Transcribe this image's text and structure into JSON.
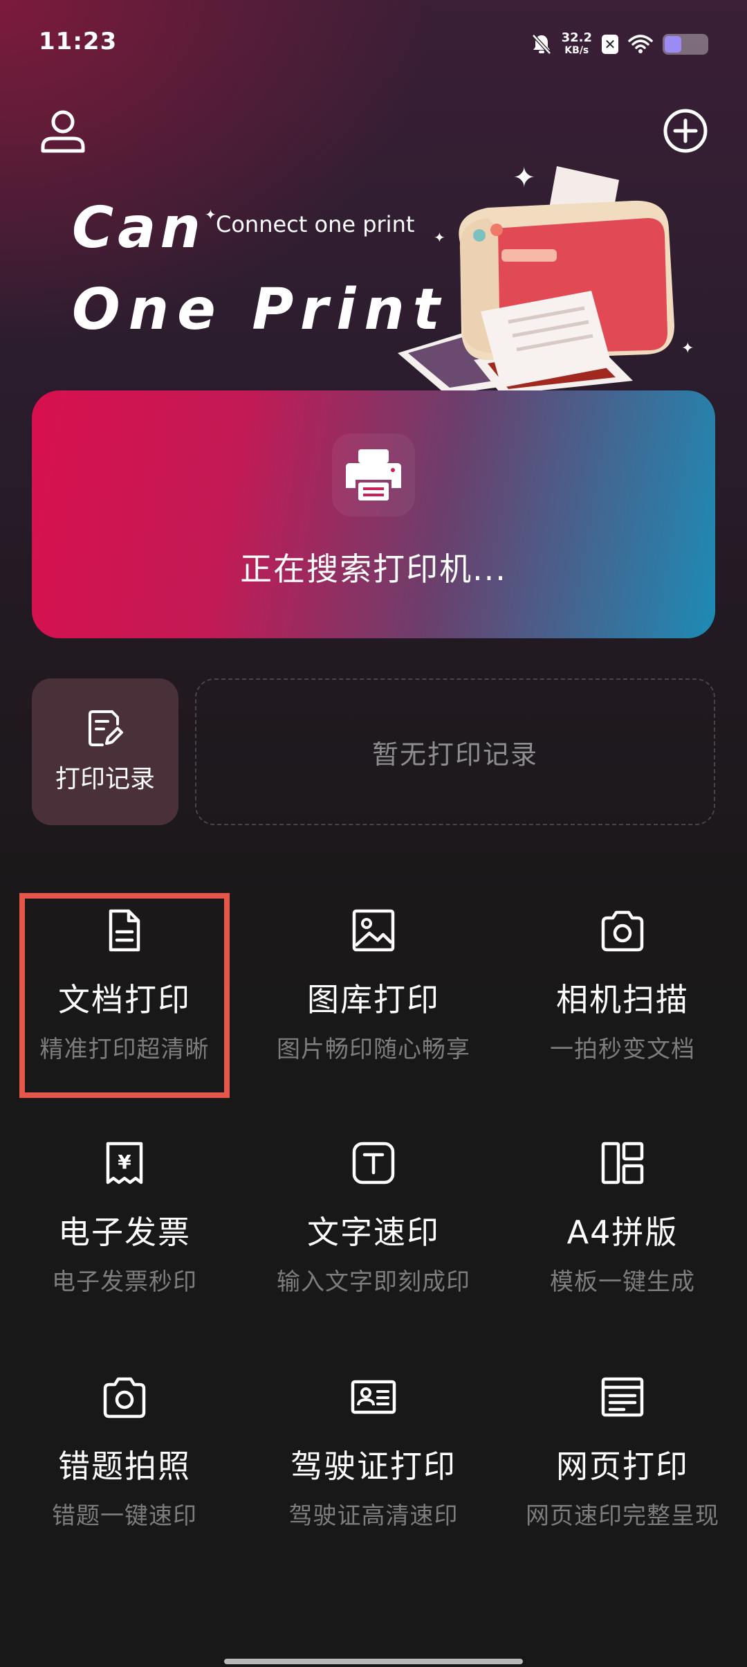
{
  "status_bar": {
    "time": "11:23",
    "net_speed_value": "32.2",
    "net_speed_unit": "KB/s",
    "x_badge": "✕",
    "battery_level_percent": 45
  },
  "header": {
    "user_icon": "user-icon",
    "add_icon": "plus-circle-icon"
  },
  "hero": {
    "line1": "Can",
    "subtitle": "Connect one print",
    "line2": "One Print"
  },
  "printer_card": {
    "status_text": "正在搜索打印机...",
    "icon": "printer-icon",
    "gradient_start": "#d9104f",
    "gradient_end": "#1d8bb5"
  },
  "records": {
    "button_label": "打印记录",
    "empty_text": "暂无打印记录"
  },
  "features": [
    {
      "title": "文档打印",
      "subtitle": "精准打印超清晰",
      "icon": "document-icon"
    },
    {
      "title": "图库打印",
      "subtitle": "图片畅印随心畅享",
      "icon": "image-icon"
    },
    {
      "title": "相机扫描",
      "subtitle": "一拍秒变文档",
      "icon": "camera-icon"
    },
    {
      "title": "电子发票",
      "subtitle": "电子发票秒印",
      "icon": "invoice-icon"
    },
    {
      "title": "文字速印",
      "subtitle": "输入文字即刻成印",
      "icon": "text-icon"
    },
    {
      "title": "A4拼版",
      "subtitle": "模板一键生成",
      "icon": "layout-icon"
    },
    {
      "title": "错题拍照",
      "subtitle": "错题一键速印",
      "icon": "camera-icon"
    },
    {
      "title": "驾驶证打印",
      "subtitle": "驾驶证高清速印",
      "icon": "id-card-icon"
    },
    {
      "title": "网页打印",
      "subtitle": "网页速印完整呈现",
      "icon": "webpage-icon"
    }
  ],
  "colors": {
    "highlight": "#e4574a",
    "record_button_bg": "#4a3139",
    "subtitle_gray": "#7d7d7d"
  }
}
